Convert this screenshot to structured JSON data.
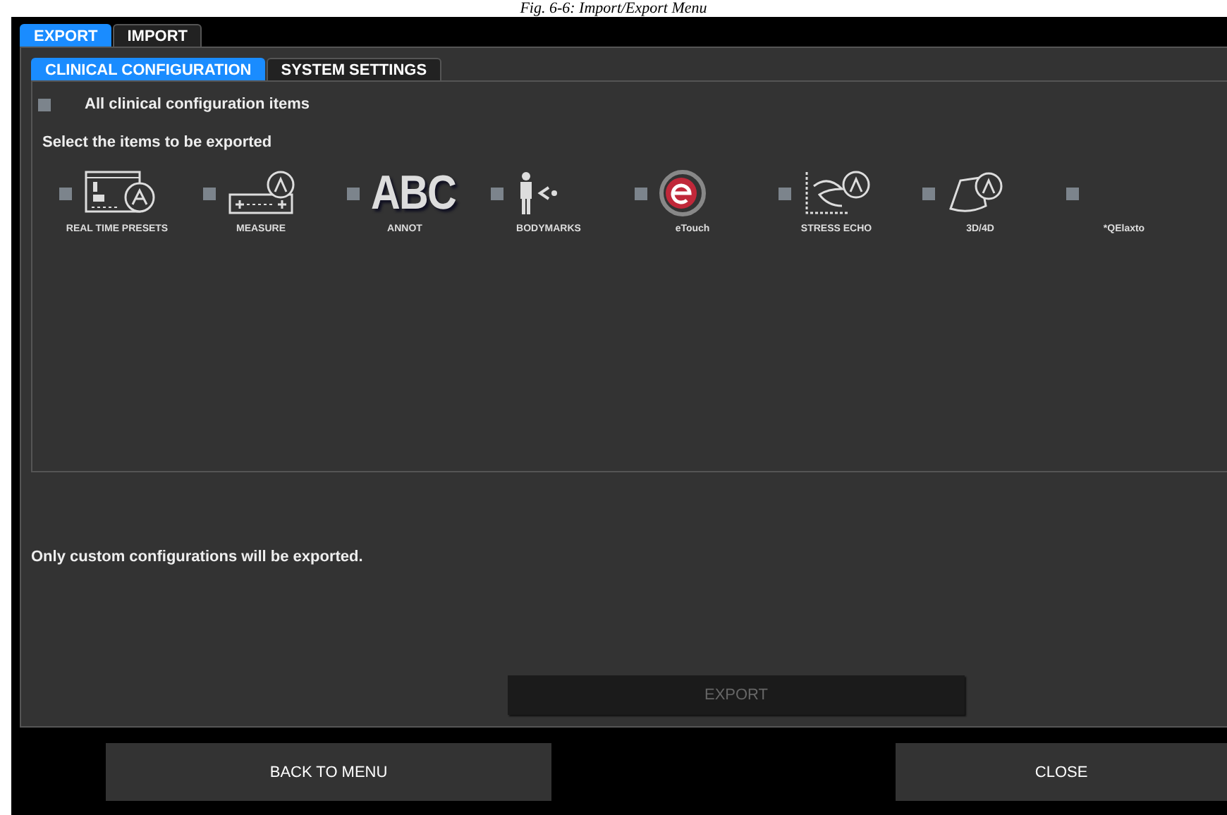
{
  "caption": "Fig. 6-6: Import/Export Menu",
  "tabs": [
    {
      "label": "EXPORT",
      "selected": true
    },
    {
      "label": "IMPORT",
      "selected": false
    }
  ],
  "subtabs": [
    {
      "label": "CLINICAL CONFIGURATION",
      "selected": true
    },
    {
      "label": "SYSTEM SETTINGS",
      "selected": false
    }
  ],
  "all_items": {
    "label": "All clinical configuration items",
    "checked": false
  },
  "instruction": "Select the items to be exported",
  "items": [
    {
      "kind": "presets",
      "label": "REAL TIME PRESETS",
      "checked": false
    },
    {
      "kind": "measure",
      "label": "MEASURE",
      "checked": false
    },
    {
      "kind": "text",
      "icon_text": "ABC",
      "label": "ANNOT",
      "checked": false
    },
    {
      "kind": "bodymarks",
      "label": "BODYMARKS",
      "checked": false
    },
    {
      "kind": "etouch",
      "label": "eTouch",
      "checked": false
    },
    {
      "kind": "stress",
      "label": "STRESS ECHO",
      "checked": false
    },
    {
      "kind": "volume",
      "label": "3D/4D",
      "checked": false
    },
    {
      "kind": "none",
      "label": "*QElaxto",
      "checked": false
    }
  ],
  "note": "Only custom configurations will be exported.",
  "export_button": {
    "label": "EXPORT",
    "disabled": true
  },
  "buttons": [
    {
      "label": "BACK TO MENU"
    },
    {
      "label": "CLOSE"
    }
  ]
}
